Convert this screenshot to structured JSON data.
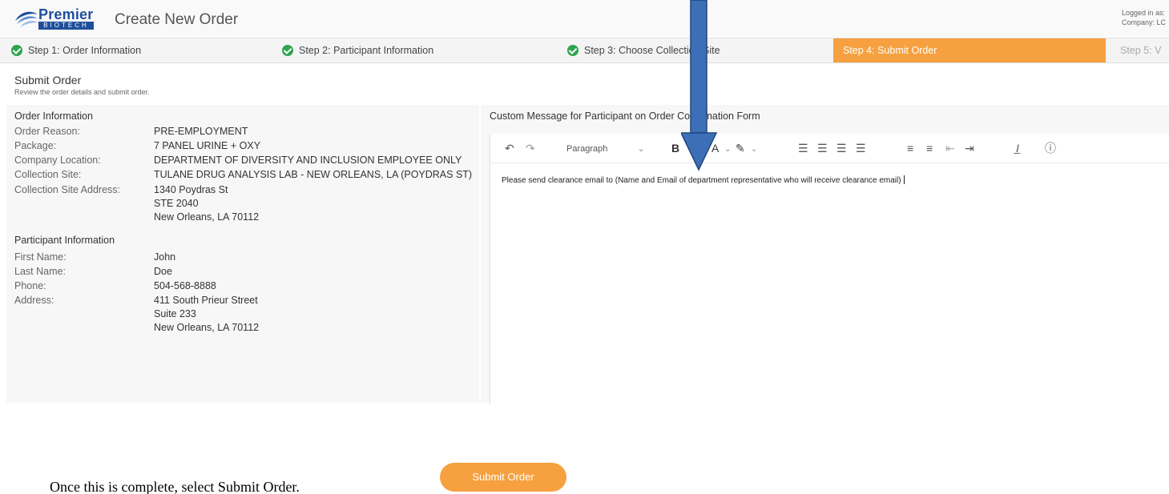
{
  "header": {
    "brand": "Premier",
    "brand_sub": "BIOTECH",
    "page_title": "Create New Order",
    "logged_in_label": "Logged in as:",
    "company_label": "Company: LC"
  },
  "steps": [
    {
      "label": "Step 1: Order Information",
      "state": "complete"
    },
    {
      "label": "Step 2: Participant Information",
      "state": "complete"
    },
    {
      "label": "Step 3: Choose Collection Site",
      "state": "complete"
    },
    {
      "label": "Step 4: Submit Order",
      "state": "active"
    },
    {
      "label": "Step 5: V",
      "state": "pending"
    }
  ],
  "submit": {
    "title": "Submit Order",
    "subtitle": "Review the order details and submit order."
  },
  "order_info": {
    "title": "Order Information",
    "reason_label": "Order Reason:",
    "reason": "PRE-EMPLOYMENT",
    "package_label": "Package:",
    "package": "7 PANEL URINE + OXY",
    "company_location_label": "Company Location:",
    "company_location": "DEPARTMENT OF DIVERSITY AND INCLUSION EMPLOYEE ONLY",
    "collection_site_label": "Collection Site:",
    "collection_site": "TULANE DRUG ANALYSIS LAB - NEW ORLEANS, LA (POYDRAS ST)",
    "collection_address_label": "Collection Site Address:",
    "collection_address_line1": "1340 Poydras St",
    "collection_address_line2": "STE 2040",
    "collection_address_line3": "New Orleans, LA 70112"
  },
  "participant_info": {
    "title": "Participant Information",
    "first_name_label": "First Name:",
    "first_name": "John",
    "last_name_label": "Last Name:",
    "last_name": "Doe",
    "phone_label": "Phone:",
    "phone": "504-568-8888",
    "address_label": "Address:",
    "address_line1": "411 South Prieur Street",
    "address_line2": "Suite 233",
    "address_line3": "New Orleans, LA 70112"
  },
  "editor": {
    "label": "Custom Message for Participant on Order Confirmation Form",
    "format": "Paragraph",
    "content": "Please send clearance email to (Name and Email of department representative who will receive clearance email)"
  },
  "submit_button": "Submit Order",
  "instruction": "Once this is complete, select Submit Order.",
  "colors": {
    "accent": "#f6a03f",
    "brand": "#1f4f9b",
    "check": "#2ea44f",
    "arrow": "#3d6fb7"
  }
}
